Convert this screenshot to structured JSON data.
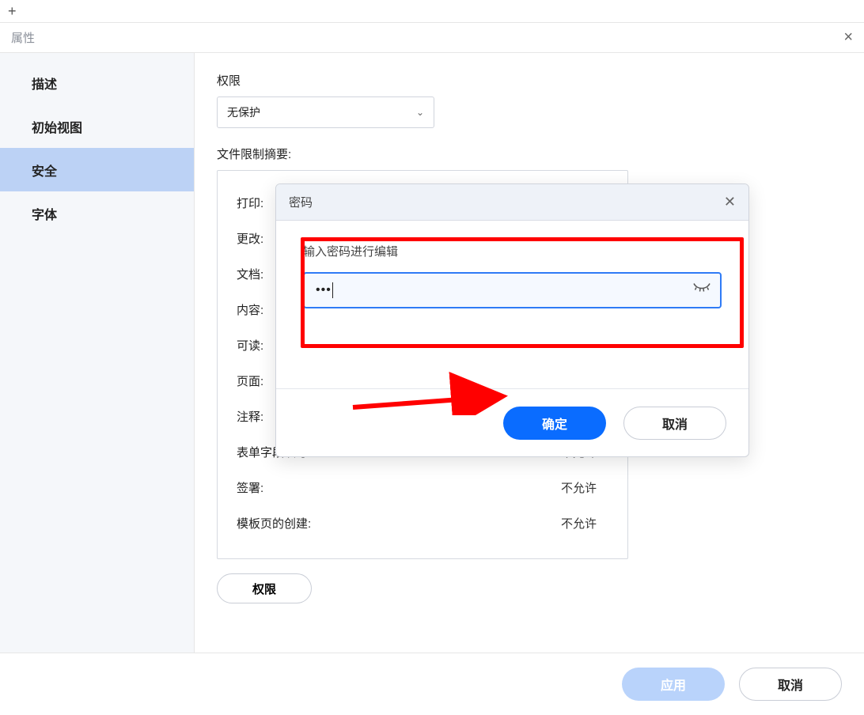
{
  "topbar": {},
  "titlebar": {
    "title": "属性",
    "close_icon": "×"
  },
  "sidebar": {
    "items": [
      {
        "label": "描述"
      },
      {
        "label": "初始视图"
      },
      {
        "label": "安全"
      },
      {
        "label": "字体"
      }
    ],
    "selected_index": 2
  },
  "main": {
    "perm_label": "权限",
    "perm_value": "无保护",
    "restrict_header": "文件限制摘要:",
    "restrict_rows": [
      {
        "label": "打印:",
        "value": ""
      },
      {
        "label": "更改:",
        "value": ""
      },
      {
        "label": "文档:",
        "value": ""
      },
      {
        "label": "内容:",
        "value": ""
      },
      {
        "label": "可读:",
        "value": ""
      },
      {
        "label": "页面:",
        "value": ""
      },
      {
        "label": "注释:",
        "value": ""
      },
      {
        "label": "表单字段填写:",
        "value": "不允许"
      },
      {
        "label": "签署:",
        "value": "不允许"
      },
      {
        "label": "模板页的创建:",
        "value": "不允许"
      }
    ],
    "perm_button": "权限"
  },
  "footer": {
    "apply": "应用",
    "cancel": "取消"
  },
  "modal": {
    "title": "密码",
    "label": "输入密码进行编辑",
    "password_mask": "•••",
    "ok": "确定",
    "cancel": "取消"
  }
}
